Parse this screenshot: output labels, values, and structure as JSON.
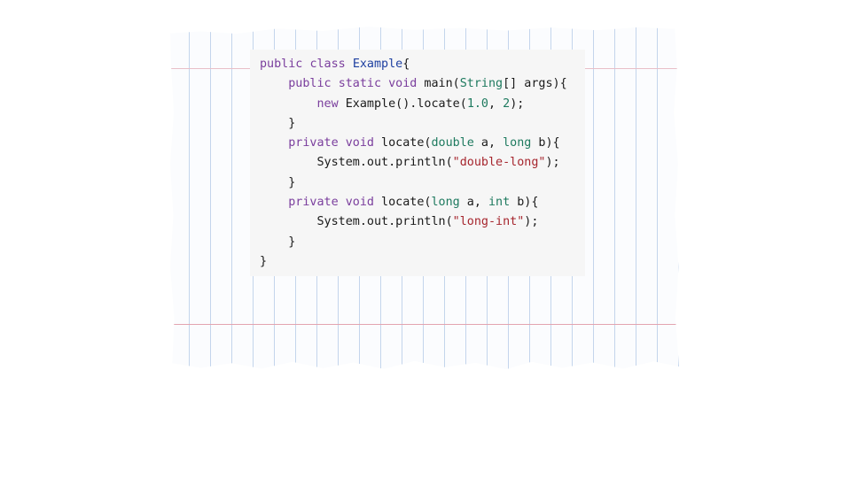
{
  "code": {
    "lines": [
      [
        {
          "t": "kw",
          "v": "public"
        },
        {
          "t": "plain",
          "v": " "
        },
        {
          "t": "kw",
          "v": "class"
        },
        {
          "t": "plain",
          "v": " "
        },
        {
          "t": "cls",
          "v": "Example"
        },
        {
          "t": "plain",
          "v": "{"
        }
      ],
      [
        {
          "t": "plain",
          "v": "    "
        },
        {
          "t": "kw",
          "v": "public"
        },
        {
          "t": "plain",
          "v": " "
        },
        {
          "t": "kw",
          "v": "static"
        },
        {
          "t": "plain",
          "v": " "
        },
        {
          "t": "kw",
          "v": "void"
        },
        {
          "t": "plain",
          "v": " main("
        },
        {
          "t": "type",
          "v": "String"
        },
        {
          "t": "plain",
          "v": "[] args){"
        }
      ],
      [
        {
          "t": "plain",
          "v": "        "
        },
        {
          "t": "kw",
          "v": "new"
        },
        {
          "t": "plain",
          "v": " Example().locate("
        },
        {
          "t": "num",
          "v": "1.0"
        },
        {
          "t": "plain",
          "v": ", "
        },
        {
          "t": "num",
          "v": "2"
        },
        {
          "t": "plain",
          "v": ");"
        }
      ],
      [
        {
          "t": "plain",
          "v": "    }"
        }
      ],
      [
        {
          "t": "plain",
          "v": "    "
        },
        {
          "t": "kw",
          "v": "private"
        },
        {
          "t": "plain",
          "v": " "
        },
        {
          "t": "kw",
          "v": "void"
        },
        {
          "t": "plain",
          "v": " locate("
        },
        {
          "t": "type",
          "v": "double"
        },
        {
          "t": "plain",
          "v": " a, "
        },
        {
          "t": "type",
          "v": "long"
        },
        {
          "t": "plain",
          "v": " b){"
        }
      ],
      [
        {
          "t": "plain",
          "v": "        System.out.println("
        },
        {
          "t": "str",
          "v": "\"double-long\""
        },
        {
          "t": "plain",
          "v": ");"
        }
      ],
      [
        {
          "t": "plain",
          "v": "    }"
        }
      ],
      [
        {
          "t": "plain",
          "v": "    "
        },
        {
          "t": "kw",
          "v": "private"
        },
        {
          "t": "plain",
          "v": " "
        },
        {
          "t": "kw",
          "v": "void"
        },
        {
          "t": "plain",
          "v": " locate("
        },
        {
          "t": "type",
          "v": "long"
        },
        {
          "t": "plain",
          "v": " a, "
        },
        {
          "t": "type",
          "v": "int"
        },
        {
          "t": "plain",
          "v": " b){"
        }
      ],
      [
        {
          "t": "plain",
          "v": "        System.out.println("
        },
        {
          "t": "str",
          "v": "\"long-int\""
        },
        {
          "t": "plain",
          "v": ");"
        }
      ],
      [
        {
          "t": "plain",
          "v": "    }"
        }
      ],
      [
        {
          "t": "plain",
          "v": "}"
        }
      ]
    ]
  },
  "colors": {
    "keyword": "#7a3e9d",
    "type": "#1e7a5f",
    "number": "#1e7a5f",
    "string": "#a6262e",
    "class_name": "#1d3fa0",
    "plain": "#1a1a1a",
    "code_background": "#f6f6f6",
    "paper": "#fbfcfe",
    "paper_rule": "#c4d5ec",
    "paper_margin": "#e3a4b0"
  }
}
